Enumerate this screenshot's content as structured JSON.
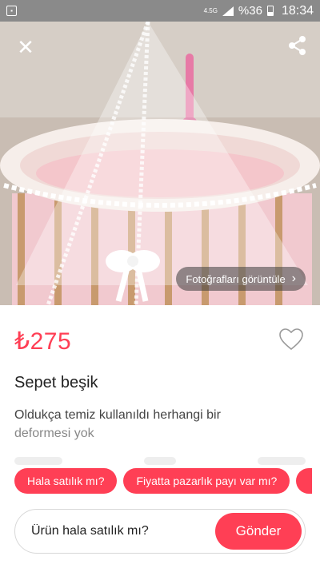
{
  "status_bar": {
    "app_icon": "gallery-icon",
    "network": "4.5G",
    "battery_text": "%36",
    "time": "18:34"
  },
  "hero": {
    "close_icon": "close-icon",
    "share_icon": "share-icon",
    "view_photos_label": "Fotoğrafları görüntüle",
    "view_photos_icon": "chevron-right-icon"
  },
  "listing": {
    "price": "₺275",
    "title": "Sepet beşik",
    "description_line1": "Oldukça temiz kullanıldı herhangi bir",
    "description_line2": "deformesi yok",
    "favorite_icon": "heart-outline-icon"
  },
  "quick_replies": [
    {
      "label": "Hala satılık mı?"
    },
    {
      "label": "Fiyatta pazarlık payı var mı?"
    }
  ],
  "message": {
    "value": "Ürün hala satılık mı?",
    "send_label": "Gönder"
  },
  "colors": {
    "accent": "#ff3f55",
    "status_bar": "#8a8a8a"
  }
}
